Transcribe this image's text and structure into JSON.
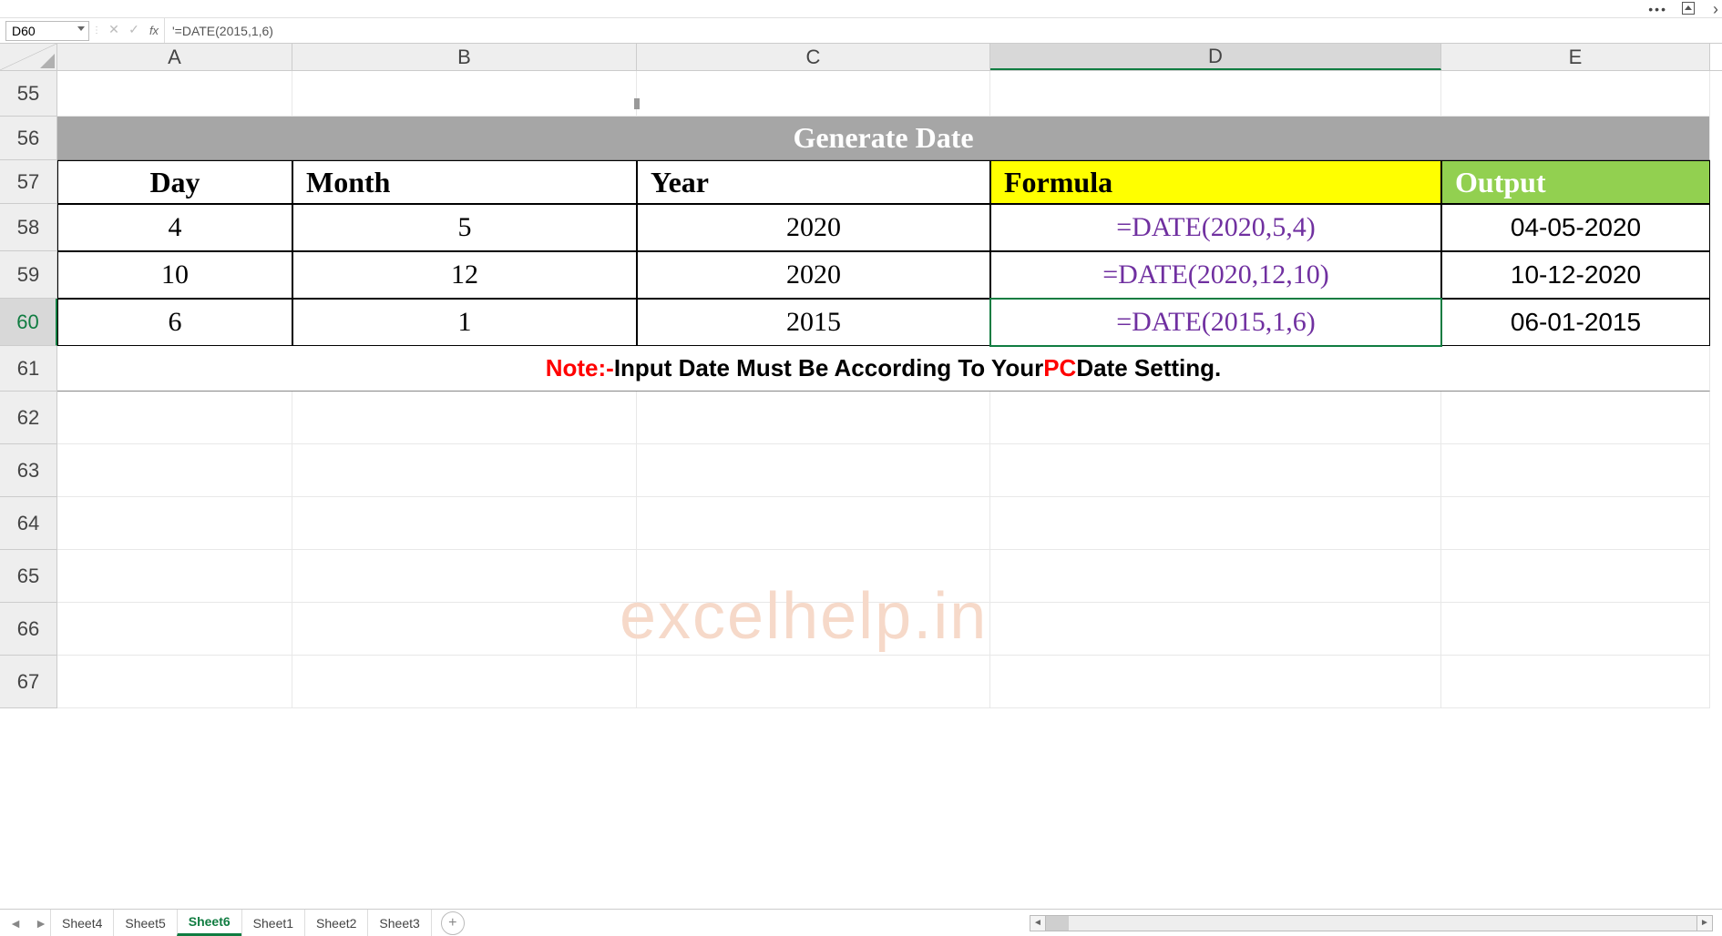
{
  "namebox": "D60",
  "formula_bar": "'=DATE(2015,1,6)",
  "columns": [
    "A",
    "B",
    "C",
    "D",
    "E"
  ],
  "rowNumbers": [
    55,
    56,
    57,
    58,
    59,
    60,
    61,
    62,
    63,
    64,
    65,
    66,
    67
  ],
  "title": "Generate Date",
  "headers": {
    "A": "Day",
    "B": "Month",
    "C": "Year",
    "D": "Formula",
    "E": "Output"
  },
  "data": [
    {
      "day": "4",
      "month": "5",
      "year": "2020",
      "formula": "=DATE(2020,5,4)",
      "output": "04-05-2020"
    },
    {
      "day": "10",
      "month": "12",
      "year": "2020",
      "formula": "=DATE(2020,12,10)",
      "output": "10-12-2020"
    },
    {
      "day": "6",
      "month": "1",
      "year": "2015",
      "formula": "=DATE(2015,1,6)",
      "output": "06-01-2015"
    }
  ],
  "note": {
    "pre": "Note:-",
    "mid": " Input Date Must Be According To Your ",
    "pc": "PC",
    "post": " Date Setting."
  },
  "watermark": "excelhelp.in",
  "tabs": [
    "Sheet4",
    "Sheet5",
    "Sheet6",
    "Sheet1",
    "Sheet2",
    "Sheet3"
  ],
  "activeTab": "Sheet6",
  "selectedCell": "D60"
}
